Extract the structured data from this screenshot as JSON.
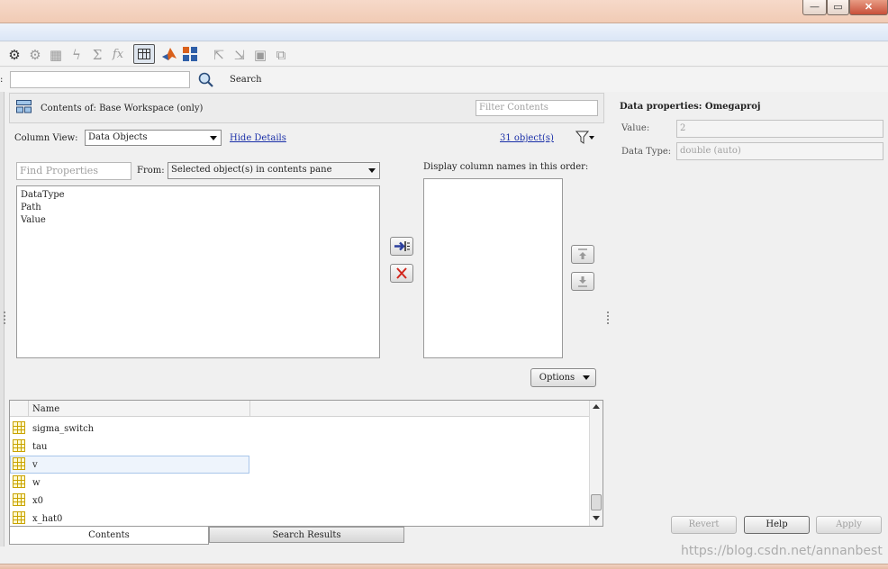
{
  "window": {
    "minimize_glyph": "—",
    "maximize_glyph": "▭",
    "close_glyph": "✕"
  },
  "toolbar": {
    "icons": [
      "gear-cog-icon",
      "gear-icon",
      "grid-disabled-icon",
      "lightning-icon",
      "sigma-arrow-icon",
      "fx-icon",
      "table-view-icon",
      "matlab-logo-icon",
      "tiles-icon",
      "export-icon",
      "import-icon",
      "save-icon",
      "copy-icon"
    ]
  },
  "search": {
    "prefix": ":",
    "query": "",
    "button_label": "Search"
  },
  "contents": {
    "header": "Contents of: Base Workspace (only)",
    "filter_placeholder": "Filter Contents",
    "column_view_label": "Column View:",
    "column_view_value": "Data Objects",
    "hide_details": "Hide Details",
    "object_count": "31 object(s)",
    "find_placeholder": "Find Properties",
    "from_label": "From:",
    "from_value": "Selected object(s) in contents pane",
    "order_label": "Display column names in this order:",
    "properties": [
      "DataType",
      "Path",
      "Value"
    ],
    "options_label": "Options"
  },
  "table": {
    "column_name": "Name",
    "rows": [
      "sigma_switch",
      "tau",
      "v",
      "w",
      "x0",
      "x_hat0"
    ],
    "selected_index": 2
  },
  "tabs": {
    "contents": "Contents",
    "search_results": "Search Results"
  },
  "properties_panel": {
    "title": "Data properties: Omegaproj",
    "value_label": "Value:",
    "value": "2",
    "datatype_label": "Data Type:",
    "datatype_value": "double (auto)"
  },
  "footer": {
    "revert": "Revert",
    "help": "Help",
    "apply": "Apply"
  },
  "watermark": "https://blog.csdn.net/annanbest"
}
